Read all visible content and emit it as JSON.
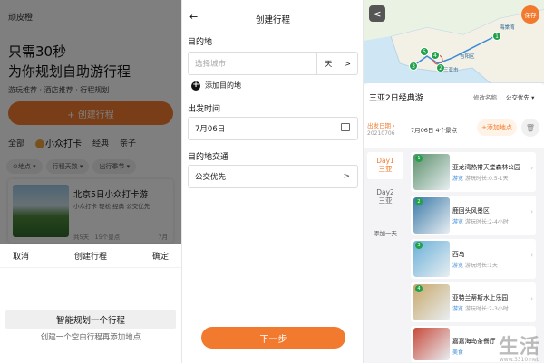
{
  "panel1": {
    "brand": "顽皮橙",
    "headline1": "只需30秒",
    "headline2": "为你规划自助游行程",
    "subline": "游玩推荐 · 酒店推荐 · 行程规划",
    "create_button": "+ 创建行程",
    "tabs": [
      "全部",
      "小众打卡",
      "经典",
      "亲子"
    ],
    "filters": [
      "⊙地点 ▾",
      "行程天数 ▾",
      "出行季节 ▾"
    ],
    "card": {
      "title": "北京5日小众打卡游",
      "desc": "小众打卡 轻松 经典 公交优先",
      "meta": "共5天 | 15个景点",
      "right": "7月"
    },
    "sheet": {
      "cancel": "取消",
      "title": "创建行程",
      "confirm": "确定",
      "option1": "智能规划一个行程",
      "option2": "创建一个空白行程再添加地点"
    }
  },
  "panel2": {
    "back": "←",
    "title": "创建行程",
    "dest_label": "目的地",
    "dest_placeholder": "选择城市",
    "days_unit": "天",
    "chevron": ">",
    "add_dest": "添加目的地",
    "add_icon": "+",
    "date_label": "出发时间",
    "date_value": "7月06日",
    "transport_label": "目的地交通",
    "transport_value": "公交优先",
    "next": "下一步"
  },
  "panel3": {
    "back": "<",
    "save": "保存",
    "map_labels": [
      "三亚市",
      "吉阳区",
      "海棠湾"
    ],
    "pins": [
      "1",
      "2",
      "3",
      "4",
      "5"
    ],
    "trip_title": "三亚2日经典游",
    "rename": "修改名称",
    "preference": "公交优先 ▾",
    "dept_label": "出发日期 ›",
    "dept_date": "20210706",
    "day_info": "7月06日  4个景点",
    "add_spot": "+添加地点",
    "days": [
      {
        "name": "Day1",
        "place": "三亚"
      },
      {
        "name": "Day2",
        "place": "三亚"
      }
    ],
    "add_day": "添加一天",
    "spots": [
      {
        "num": "1",
        "name": "亚龙湾热带天堂森林公园",
        "tag": "游览",
        "dur": "游玩时长:0.5-1天",
        "color": "#5b8f6a"
      },
      {
        "num": "2",
        "name": "鹿回头风景区",
        "tag": "游览",
        "dur": "游玩时长:2-4小时",
        "color": "#3a7aa8"
      },
      {
        "num": "3",
        "name": "西岛",
        "tag": "游览",
        "dur": "游玩时长:1天",
        "color": "#6ab0d8"
      },
      {
        "num": "4",
        "name": "亚特兰蒂斯水上乐园",
        "tag": "游览",
        "dur": "游玩时长:2-3小时",
        "color": "#c8a86a"
      },
      {
        "num": "",
        "name": "嘉嘉海岛茶餐厅",
        "tag": "美食",
        "dur": "",
        "color": "#c84a3a"
      }
    ],
    "watermark": "生活",
    "watermark_sub": "www.3310.net"
  }
}
